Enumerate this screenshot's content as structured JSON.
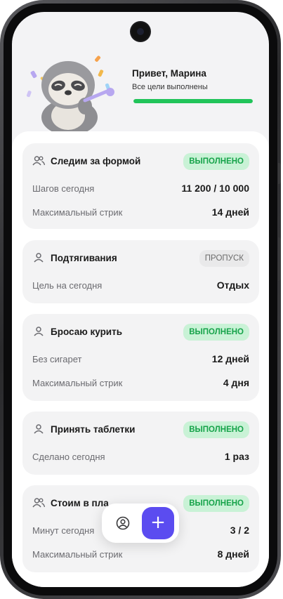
{
  "header": {
    "greeting": "Привет, Марина",
    "status": "Все цели выполнены",
    "progress": 1.0
  },
  "goals": [
    {
      "title": "Следим за формой",
      "icon": "group-icon",
      "badge": "ВЫПОЛНЕНО",
      "rows": [
        {
          "label": "Шагов сегодня",
          "value": "11 200 / 10 000"
        },
        {
          "label": "Максимальный стрик",
          "value": "14 дней"
        }
      ]
    },
    {
      "title": "Подтягивания",
      "icon": "person-icon",
      "badge": "ПРОПУСК",
      "rows": [
        {
          "label": "Цель на сегодня",
          "value": "Отдых"
        }
      ]
    },
    {
      "title": "Бросаю курить",
      "icon": "person-icon",
      "badge": "ВЫПОЛНЕНО",
      "rows": [
        {
          "label": "Без сигарет",
          "value": "12 дней"
        },
        {
          "label": "Максимальный стрик",
          "value": "4 дня"
        }
      ]
    },
    {
      "title": "Принять таблетки",
      "icon": "person-icon",
      "badge": "ВЫПОЛНЕНО",
      "rows": [
        {
          "label": "Сделано сегодня",
          "value": "1 раз"
        }
      ]
    },
    {
      "title": "Стоим в пла",
      "icon": "group-icon",
      "badge": "ВЫПОЛНЕНО",
      "rows": [
        {
          "label": "Минут сегодня",
          "value": "3 / 2"
        },
        {
          "label": "Максимальный стрик",
          "value": "8 дней"
        }
      ]
    }
  ],
  "bottom_bar": {
    "profile_icon": "profile-icon",
    "add_label": "+"
  },
  "colors": {
    "accent": "#5b4cf0",
    "success": "#21c45a",
    "done_badge_bg": "#c9f2d6",
    "done_badge_text": "#16a34a"
  }
}
